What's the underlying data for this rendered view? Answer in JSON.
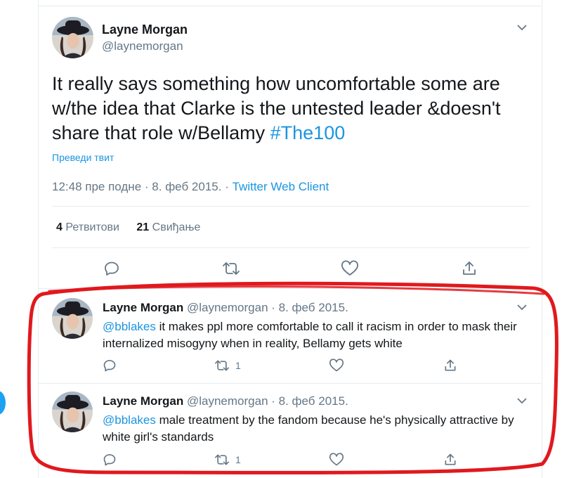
{
  "main_tweet": {
    "author_name": "Layne Morgan",
    "author_handle": "@laynemorgan",
    "text_before": "It really says something how uncomfortable some are w/the idea that Clarke is the untested leader &doesn't share that role w/Bellamy ",
    "hashtag": "#The100",
    "translate_label": "Преведи твит",
    "time": "12:48 пре подне",
    "date": "8. феб 2015.",
    "separator": "·",
    "source": "Twitter Web Client",
    "retweet_count": "4",
    "retweet_label": "Ретвитови",
    "like_count": "21",
    "like_label": "Свиђање"
  },
  "replies": [
    {
      "author_name": "Layne Morgan",
      "author_handle": "@laynemorgan",
      "date": "· 8. феб 2015.",
      "mention": "@bblakes",
      "text": " it makes ppl more comfortable to call it racism in order to mask their internalized misogyny when in reality, Bellamy gets white",
      "retweet_count": "1"
    },
    {
      "author_name": "Layne Morgan",
      "author_handle": "@laynemorgan",
      "date": "· 8. феб 2015.",
      "mention": "@bblakes",
      "text": " male treatment by the fandom because he's physically attractive by white  girl's standards",
      "retweet_count": "1"
    }
  ],
  "icons": {
    "reply": "reply-bubble-icon",
    "retweet": "retweet-arrows-icon",
    "like": "heart-icon",
    "share": "share-upload-icon",
    "caret": "chevron-down-icon"
  },
  "colors": {
    "link": "#1b95e0",
    "secondary_text": "#657786",
    "primary_text": "#14171a",
    "annotation": "#e0191e"
  }
}
